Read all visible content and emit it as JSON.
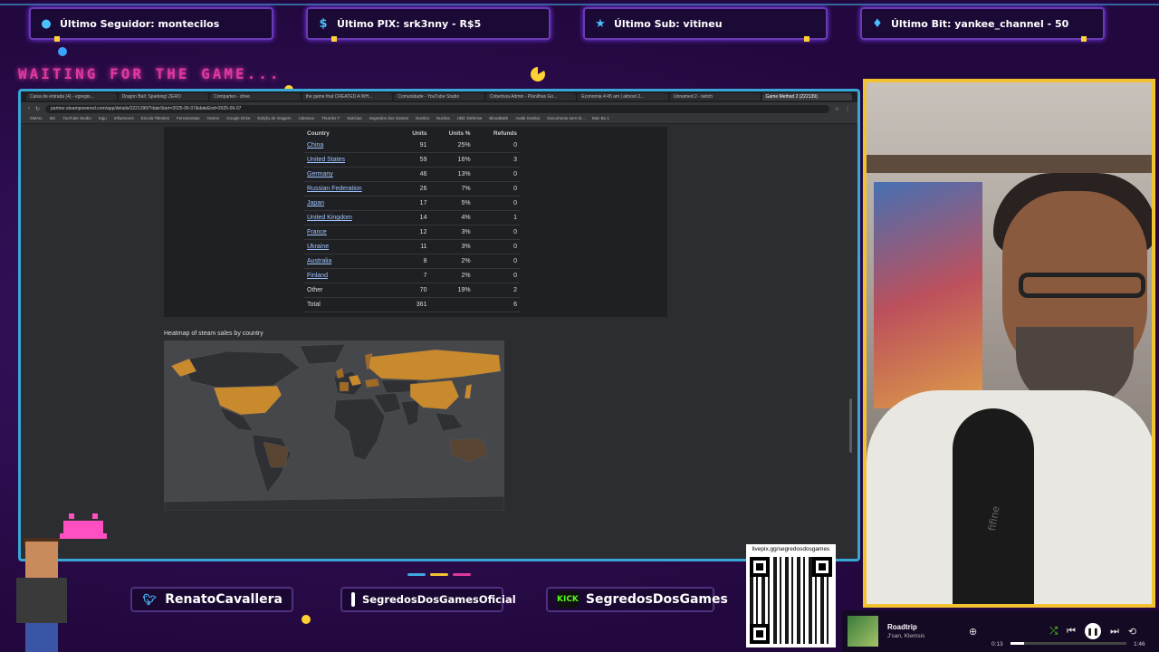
{
  "alerts": [
    {
      "icon": "user-icon",
      "label": "Último Seguidor: montecilos"
    },
    {
      "icon": "dollar-icon",
      "label": "Último PIX: srk3nny - R$5"
    },
    {
      "icon": "star-icon",
      "label": "Último Sub: vitineu"
    },
    {
      "icon": "diamond-icon",
      "label": "Último Bit: yankee_channel - 50"
    }
  ],
  "waiting_text": "WAITING FOR THE GAME...",
  "browser": {
    "tabs": [
      "Caixa de entrada (4) - egregio...",
      "Dragon Ball: Sparking! ZERO",
      "Compartes - drive",
      "the game that CREATED A WH...",
      "Comunidade - YouTube Studio",
      "Cobertura Admin - Planilhas Go...",
      "Economia 4:45 am | almost 2...",
      "Unnamed 2 - twitch",
      "Game Method 2 (222139)"
    ],
    "url": "partner.steampowered.com/app/details/2221390/?dateStart=2025-06-07&dateEnd=2025-06-07",
    "bookmarks": [
      "GMAIL",
      "BS",
      "YouTube Studio",
      "Kaju",
      "Influencers",
      "Escola Tiktokes",
      "Ferramentas",
      "Outros",
      "Google Drive",
      "Edição de imagem",
      "Adessoo",
      "Thumbs T",
      "Notícias",
      "Segredos dos Games",
      "Nuvilca",
      "Nuvilca",
      "Ukilc Defense",
      "BloodBath",
      "Avatk Gankar",
      "Documento sem tít...",
      "Mac Bo 1"
    ]
  },
  "sales_table": {
    "headers": [
      "Country",
      "Units",
      "Units %",
      "Refunds"
    ],
    "rows": [
      {
        "country": "China",
        "units": "91",
        "pct": "25%",
        "extra": "0"
      },
      {
        "country": "United States",
        "units": "59",
        "pct": "16%",
        "extra": "3"
      },
      {
        "country": "Germany",
        "units": "46",
        "pct": "13%",
        "extra": "0"
      },
      {
        "country": "Russian Federation",
        "units": "26",
        "pct": "7%",
        "extra": "0"
      },
      {
        "country": "Japan",
        "units": "17",
        "pct": "5%",
        "extra": "0"
      },
      {
        "country": "United Kingdom",
        "units": "14",
        "pct": "4%",
        "extra": "1"
      },
      {
        "country": "France",
        "units": "12",
        "pct": "3%",
        "extra": "0"
      },
      {
        "country": "Ukraine",
        "units": "11",
        "pct": "3%",
        "extra": "0"
      },
      {
        "country": "Australia",
        "units": "8",
        "pct": "2%",
        "extra": "0"
      },
      {
        "country": "Finland",
        "units": "7",
        "pct": "2%",
        "extra": "0"
      },
      {
        "country": "Other",
        "units": "70",
        "pct": "19%",
        "extra": "2"
      },
      {
        "country": "Total",
        "units": "361",
        "pct": "",
        "extra": "6"
      }
    ]
  },
  "heatmap": {
    "title": "Heatmap of steam sales by country",
    "colors": {
      "high": "#c98a2e",
      "mid": "#a36a26",
      "low": "#5a4532",
      "none": "#2f3033",
      "ocean": "#46474a"
    }
  },
  "socials": [
    {
      "icon": "twitter-icon",
      "handle": "RenatoCavallera"
    },
    {
      "icon": "instagram-icon",
      "handle": "SegredosDosGamesOficial"
    },
    {
      "icon": "kick-icon",
      "handle": "SegredosDosGames",
      "badge": "KICK"
    }
  ],
  "qr": {
    "label": "livepix.gg/segredosdosgames"
  },
  "player": {
    "title": "Roadtrip",
    "artist": "J'san, Klemsis",
    "elapsed": "0:13",
    "duration": "1:46",
    "progress": 0.12
  },
  "webcam": {
    "mic_brand": "fifine"
  }
}
